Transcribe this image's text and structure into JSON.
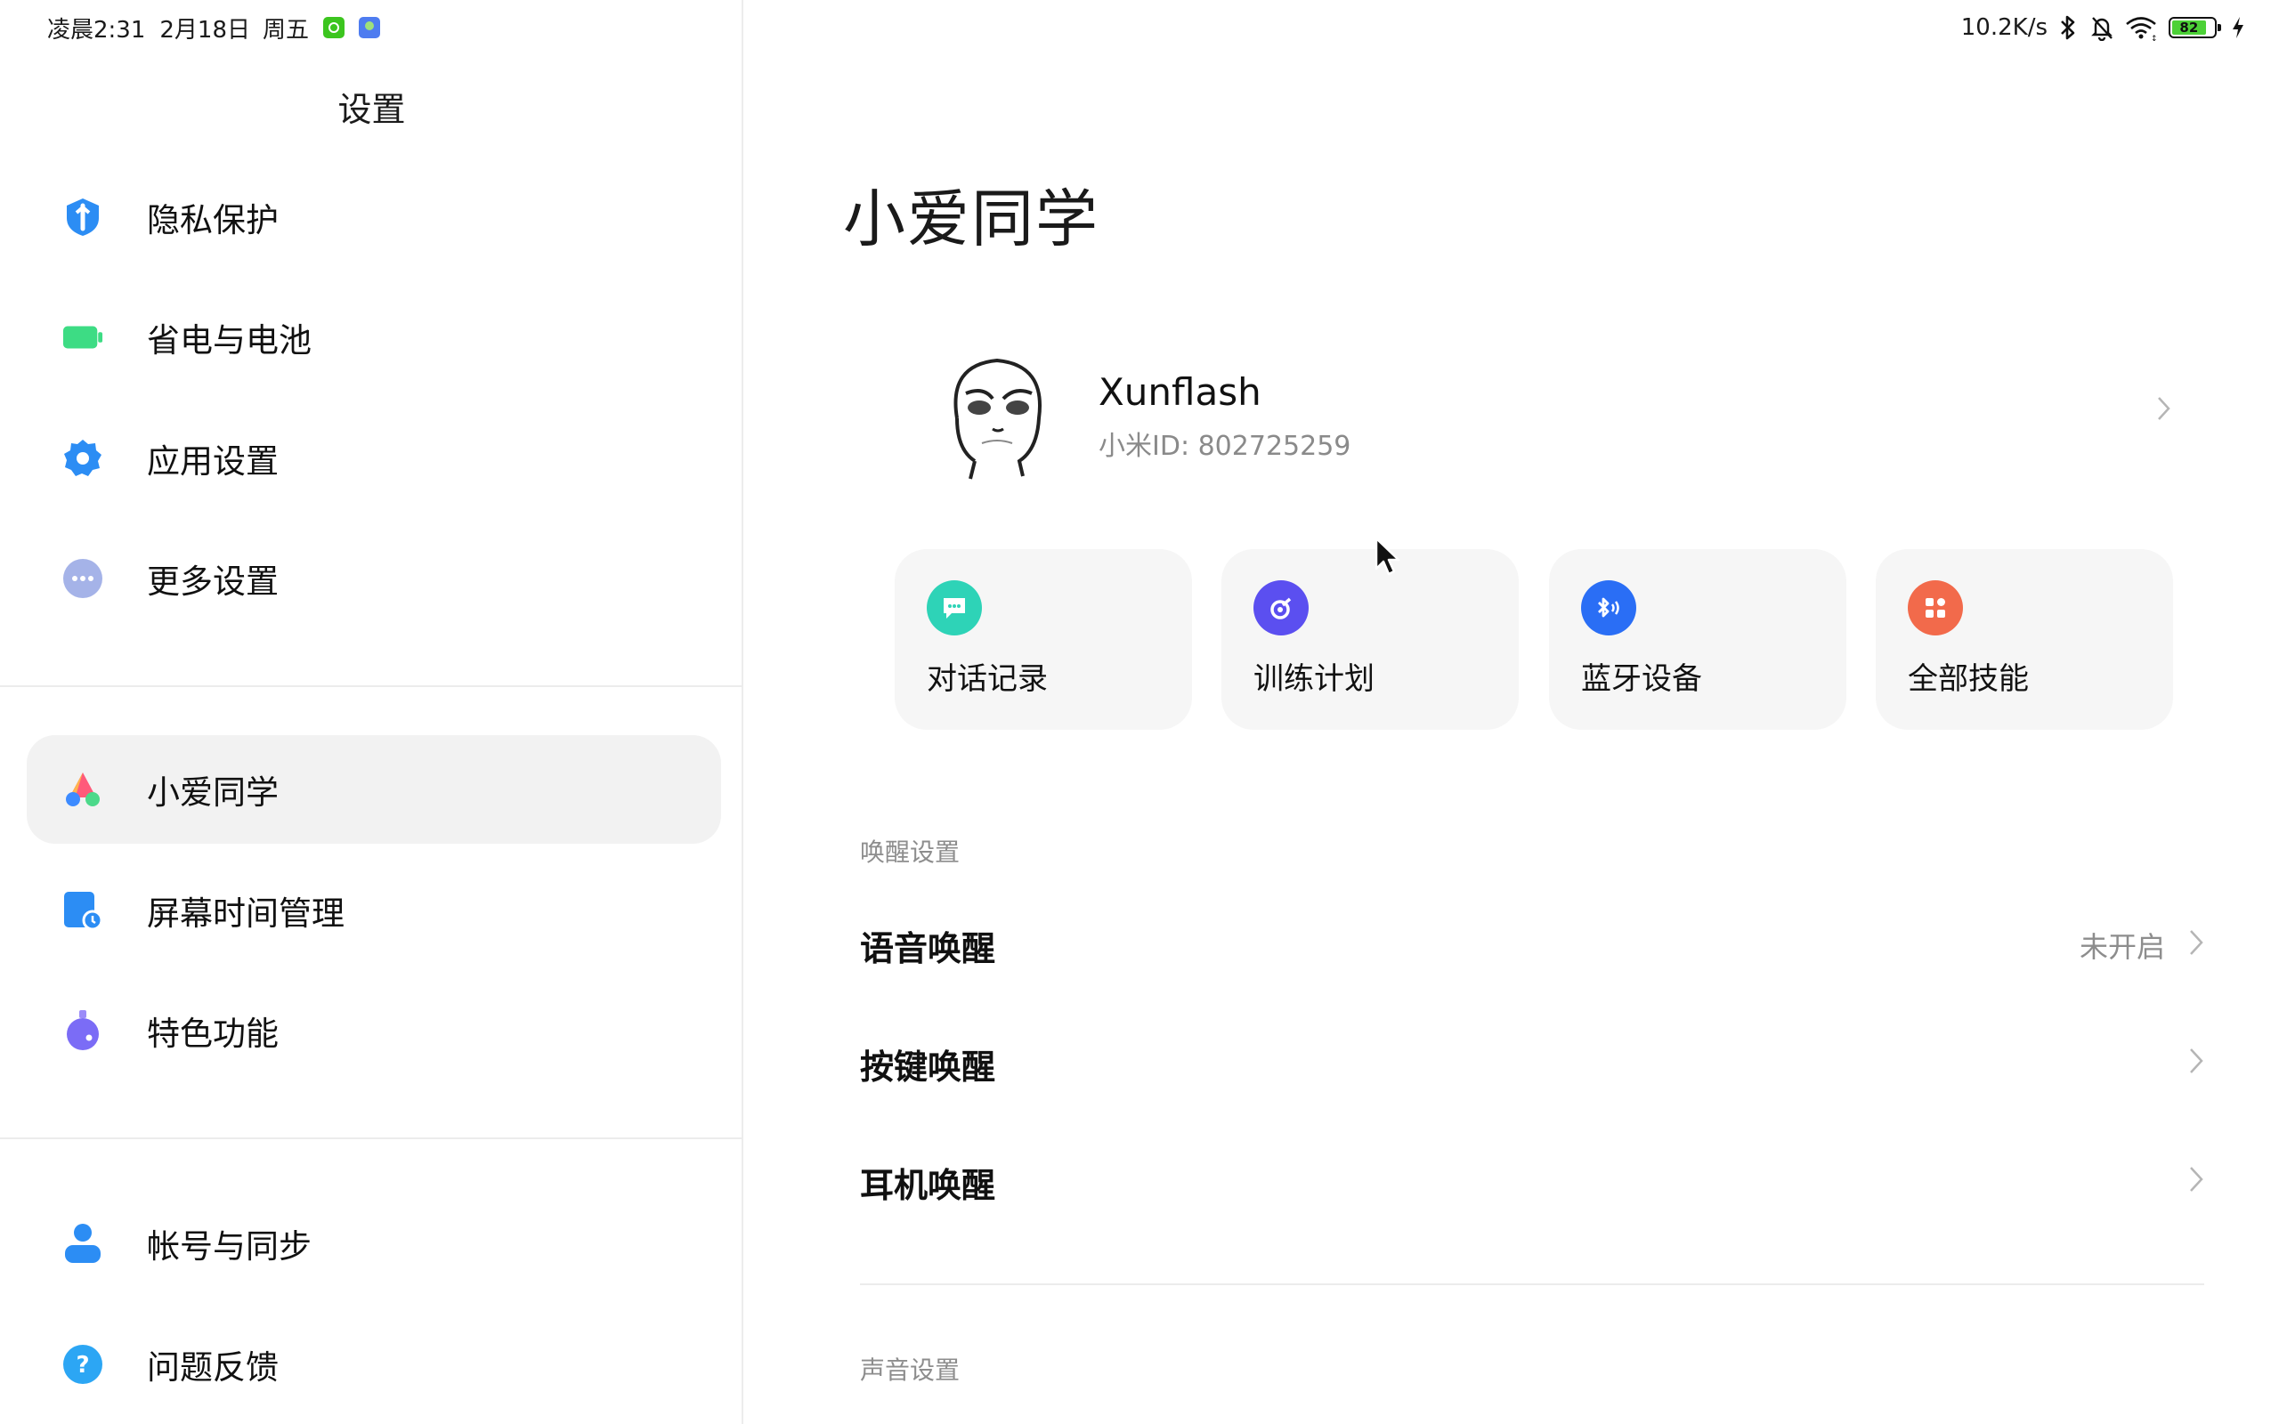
{
  "status_bar": {
    "time": "凌晨2:31",
    "date": "2月18日",
    "weekday": "周五",
    "notification_icons": [
      "wechat-icon",
      "gallery-icon"
    ],
    "network_speed": "10.2K/s",
    "system_icons": [
      "bluetooth-icon",
      "mute-icon",
      "wifi-icon",
      "battery-icon",
      "charging-icon"
    ],
    "battery_level": "82"
  },
  "sidebar": {
    "title": "设置",
    "groups": [
      {
        "items": [
          {
            "label": "隐私保护",
            "icon": "privacy-shield-icon",
            "color": "#2c8df4"
          },
          {
            "label": "省电与电池",
            "icon": "battery-icon",
            "color": "#3ddc84"
          },
          {
            "label": "应用设置",
            "icon": "gear-icon",
            "color": "#2c8df4"
          },
          {
            "label": "更多设置",
            "icon": "more-dots-icon",
            "color": "#a5b3e8"
          }
        ]
      },
      {
        "items": [
          {
            "label": "小爱同学",
            "icon": "xiaoai-icon",
            "active": true
          },
          {
            "label": "屏幕时间管理",
            "icon": "screen-time-icon",
            "color": "#2c8df4"
          },
          {
            "label": "特色功能",
            "icon": "feature-icon",
            "color": "#7b6cf6"
          }
        ]
      },
      {
        "items": [
          {
            "label": "帐号与同步",
            "icon": "account-icon",
            "color": "#2c8df4"
          },
          {
            "label": "问题反馈",
            "icon": "help-icon",
            "color": "#2ca6f4"
          }
        ]
      }
    ]
  },
  "main": {
    "title": "小爱同学",
    "profile": {
      "name": "Xunflash",
      "id_text": "小米ID: 802725259"
    },
    "tiles": [
      {
        "label": "对话记录",
        "icon": "chat-record-icon",
        "color": "#2ed3b7"
      },
      {
        "label": "训练计划",
        "icon": "training-icon",
        "color": "#5b4ff0"
      },
      {
        "label": "蓝牙设备",
        "icon": "bluetooth-device-icon",
        "color": "#2a6ef5"
      },
      {
        "label": "全部技能",
        "icon": "all-skills-icon",
        "color": "#f26a4b"
      }
    ],
    "wake_section": {
      "header": "唤醒设置",
      "rows": [
        {
          "label": "语音唤醒",
          "value": "未开启"
        },
        {
          "label": "按键唤醒",
          "value": ""
        },
        {
          "label": "耳机唤醒",
          "value": ""
        }
      ]
    },
    "sound_section": {
      "header": "声音设置"
    }
  }
}
